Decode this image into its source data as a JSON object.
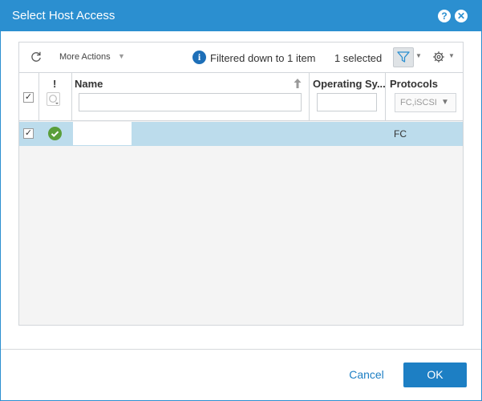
{
  "dialog": {
    "title": "Select Host Access",
    "help_glyph": "?",
    "close_glyph": "✕"
  },
  "toolbar": {
    "more_actions_label": "More Actions",
    "filter_status": "Filtered down to 1 item",
    "selection_count": "1 selected",
    "info_glyph": "i"
  },
  "table": {
    "columns": {
      "status": "!",
      "name": "Name",
      "os": "Operating Sy...",
      "protocols": "Protocols"
    },
    "protocol_filter_value": "FC,iSCSI",
    "rows": [
      {
        "checked": true,
        "status": "ok",
        "name": "",
        "os": "",
        "protocols": "FC"
      }
    ]
  },
  "footer": {
    "cancel_label": "Cancel",
    "ok_label": "OK"
  },
  "colors": {
    "title_bar": "#2b8fd0",
    "primary_button": "#1d7fc4",
    "selected_row": "#bcdcec",
    "status_ok": "#5a9e3a"
  }
}
